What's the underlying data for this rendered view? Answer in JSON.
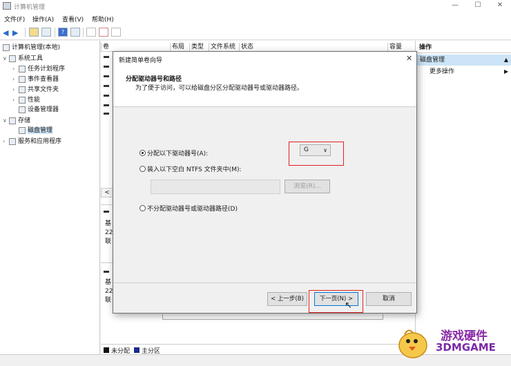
{
  "window": {
    "title": "计算机管理",
    "controls": [
      "—",
      "☐",
      "✕"
    ]
  },
  "menu": [
    "文件(F)",
    "操作(A)",
    "查看(V)",
    "帮助(H)"
  ],
  "tree": {
    "root": "计算机管理(本地)",
    "system_tools": "系统工具",
    "task_scheduler": "任务计划程序",
    "event_viewer": "事件查看器",
    "shared_folders": "共享文件夹",
    "performance": "性能",
    "device_manager": "设备管理器",
    "storage": "存储",
    "disk_management": "磁盘管理",
    "services_apps": "服务和应用程序"
  },
  "columns": [
    "卷",
    "布局",
    "类型",
    "文件系统",
    "状态",
    "容量"
  ],
  "disk_rows": [
    {
      "l1": "基",
      "l2": "22",
      "l3": "联"
    },
    {
      "l1": "基",
      "l2": "22",
      "l3": "联"
    }
  ],
  "legend": {
    "unallocated": "未分配",
    "primary": "主分区",
    "unallocated_color": "#111111",
    "primary_color": "#1c2c8c"
  },
  "actions": {
    "header": "操作",
    "selected": "磁盘管理",
    "more": "更多操作"
  },
  "dialog": {
    "title": "新建简单卷向导",
    "close": "✕",
    "heading": "分配驱动器号和路径",
    "subheading": "为了便于访问，可以给磁盘分区分配驱动器号或驱动器路径。",
    "option_assign": "分配以下驱动器号(A):",
    "drive_letter": "G",
    "option_mount": "装入以下空白 NTFS 文件夹中(M):",
    "browse": "浏览(R)...",
    "option_none": "不分配驱动器号或驱动器路径(D)",
    "back": "< 上一步(B)",
    "next": "下一页(N) >",
    "cancel": "取消"
  },
  "watermark": {
    "line1": "游戏硬件",
    "line2": "3DMGAME"
  }
}
